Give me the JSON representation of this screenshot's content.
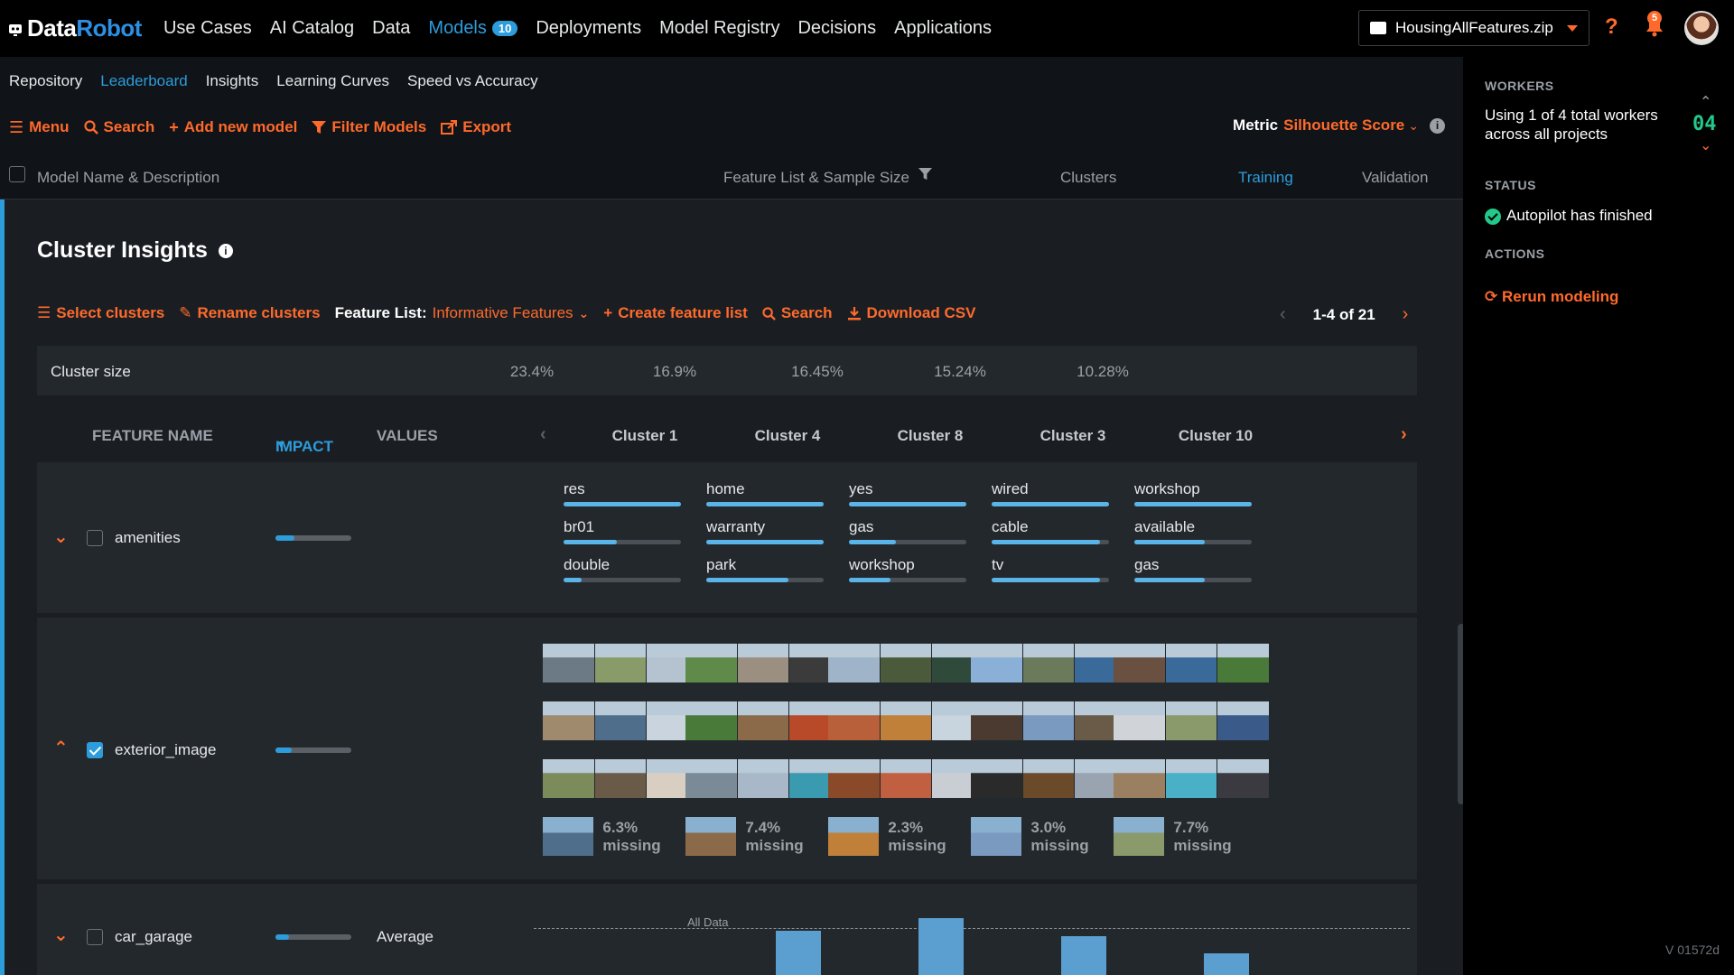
{
  "topbar": {
    "logo_data": "Data",
    "logo_robot": "Robot",
    "nav": [
      "Use Cases",
      "AI Catalog",
      "Data",
      "Models",
      "Deployments",
      "Model Registry",
      "Decisions",
      "Applications"
    ],
    "models_badge": "10",
    "project": "HousingAllFeatures.zip",
    "help": "?",
    "notifications": "5"
  },
  "subnav": {
    "tabs": [
      "Repository",
      "Leaderboard",
      "Insights",
      "Learning Curves",
      "Speed vs Accuracy"
    ]
  },
  "toolbar": {
    "menu": "Menu",
    "search": "Search",
    "add_model": "Add new model",
    "filter": "Filter Models",
    "export": "Export",
    "metric_label": "Metric",
    "metric_value": "Silhouette Score"
  },
  "columns": {
    "model_name": "Model Name & Description",
    "feature_list": "Feature List & Sample Size",
    "clusters": "Clusters",
    "training": "Training",
    "validation": "Validation"
  },
  "cluster_insights": {
    "title": "Cluster Insights",
    "select_clusters": "Select clusters",
    "rename_clusters": "Rename clusters",
    "feature_list_label": "Feature List:",
    "feature_list_value": "Informative Features",
    "create_feature_list": "Create feature list",
    "search": "Search",
    "download_csv": "Download CSV",
    "pager": "1-4 of 21",
    "cluster_size_label": "Cluster size",
    "cluster_sizes": [
      "23.4%",
      "16.9%",
      "16.45%",
      "15.24%",
      "10.28%"
    ],
    "headers": {
      "feature_name": "FEATURE NAME",
      "impact": "IMPACT",
      "values": "VALUES"
    },
    "clusters": [
      "Cluster 1",
      "Cluster 4",
      "Cluster 8",
      "Cluster 3",
      "Cluster 10"
    ],
    "rows": {
      "amenities": {
        "name": "amenities",
        "impact": 0.25,
        "clusters": [
          [
            {
              "t": "res",
              "v": 1.0
            },
            {
              "t": "br01",
              "v": 0.45
            },
            {
              "t": "double",
              "v": 0.15
            }
          ],
          [
            {
              "t": "home",
              "v": 1.0
            },
            {
              "t": "warranty",
              "v": 1.0
            },
            {
              "t": "park",
              "v": 0.7
            }
          ],
          [
            {
              "t": "yes",
              "v": 1.0
            },
            {
              "t": "gas",
              "v": 0.4
            },
            {
              "t": "workshop",
              "v": 0.35
            }
          ],
          [
            {
              "t": "wired",
              "v": 1.0
            },
            {
              "t": "cable",
              "v": 0.92
            },
            {
              "t": "tv",
              "v": 0.92
            }
          ],
          [
            {
              "t": "workshop",
              "v": 1.0
            },
            {
              "t": "available",
              "v": 0.6
            },
            {
              "t": "gas",
              "v": 0.6
            }
          ]
        ]
      },
      "exterior_image": {
        "name": "exterior_image",
        "impact": 0.22,
        "missing": [
          "6.3% missing",
          "7.4% missing",
          "2.3% missing",
          "3.0% missing",
          "7.7% missing"
        ]
      },
      "car_garage": {
        "name": "car_garage",
        "impact": 0.18,
        "values_label": "Average",
        "reference_label": "All Data"
      }
    }
  },
  "side": {
    "workers_title": "WORKERS",
    "workers_text": "Using 1 of 4 total workers across all projects",
    "workers_count": "04",
    "status_title": "STATUS",
    "status_text": "Autopilot has finished",
    "actions_title": "ACTIONS",
    "rerun": "Rerun modeling",
    "version": "V 01572d"
  },
  "colors": {
    "accent": "#ff6a2b",
    "link": "#2d9cdb",
    "success": "#22c98a"
  }
}
